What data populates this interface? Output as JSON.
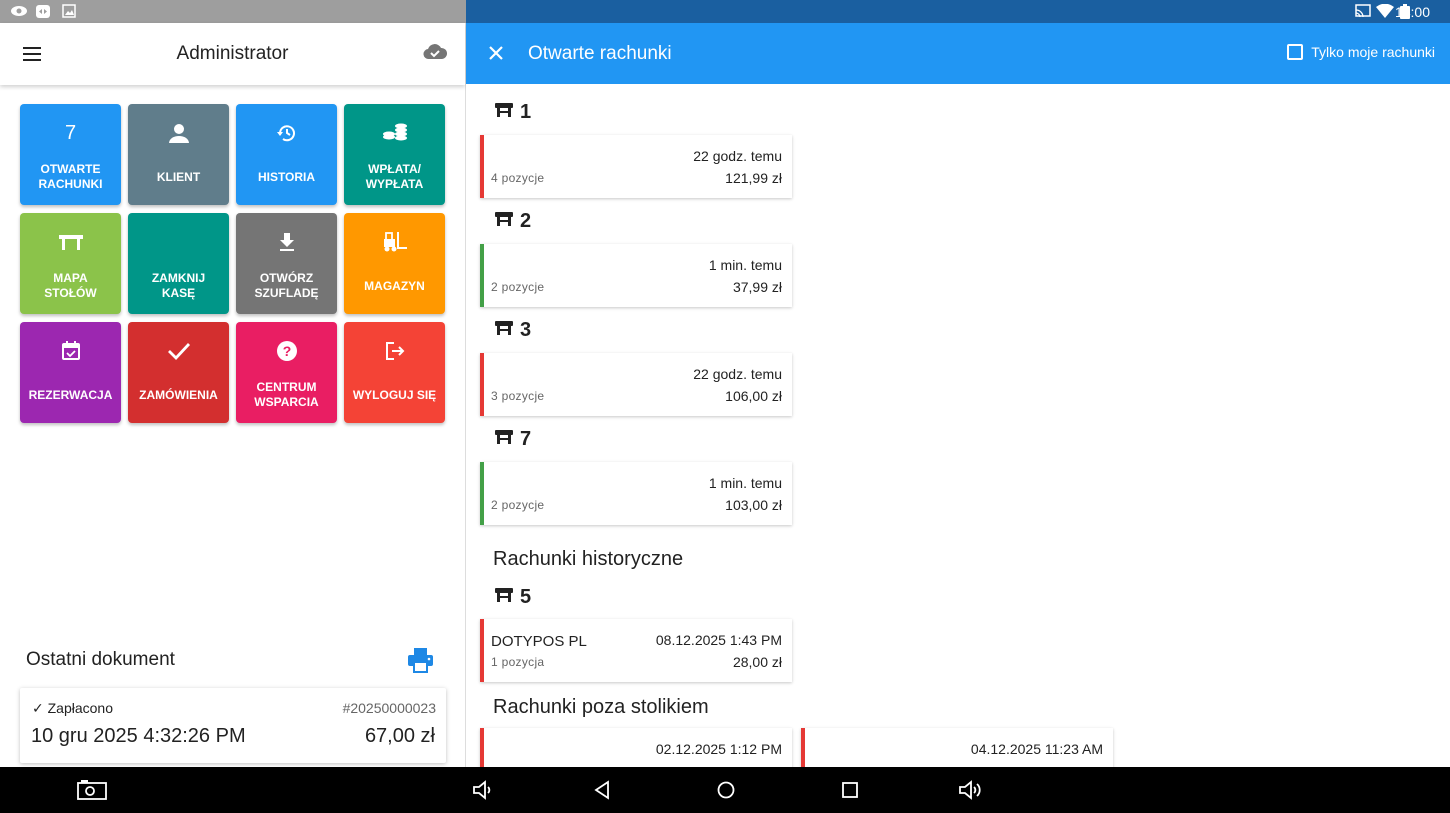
{
  "status": {
    "time": "14:00"
  },
  "left": {
    "title": "Administrator",
    "tiles": [
      {
        "label": "OTWARTE\nRACHUNKI",
        "icon_text": "7",
        "icon": "count-7",
        "color": "#2196f3"
      },
      {
        "label": "KLIENT",
        "icon": "person-icon",
        "color": "#607d8b"
      },
      {
        "label": "HISTORIA",
        "icon": "history-icon",
        "color": "#2196f3"
      },
      {
        "label": "WPŁATA/\nWYPŁATA",
        "icon": "coins-icon",
        "color": "#009688"
      },
      {
        "label": "MAPA\nSTOŁÓW",
        "icon": "table-icon",
        "color": "#8bc34a"
      },
      {
        "label": "ZAMKNIJ\nKASĘ",
        "icon": "none",
        "color": "#009688"
      },
      {
        "label": "OTWÓRZ\nSZUFLADĘ",
        "icon": "download-icon",
        "color": "#757575"
      },
      {
        "label": "MAGAZYN",
        "icon": "forklift-icon",
        "color": "#ff9800"
      },
      {
        "label": "REZERWACJA",
        "icon": "calendar-icon",
        "color": "#9c27b0"
      },
      {
        "label": "ZAMÓWIENIA",
        "icon": "check-icon",
        "color": "#d32f2f"
      },
      {
        "label": "CENTRUM\nWSPARCIA",
        "icon": "help-icon",
        "color": "#e91e63"
      },
      {
        "label": "WYLOGUJ SIĘ",
        "icon": "logout-icon",
        "color": "#f44336"
      }
    ],
    "last_doc": {
      "title": "Ostatni dokument",
      "status": "✓ Zapłacono",
      "number": "#20250000023",
      "date": "10 gru 2025 4:32:26 PM",
      "amount": "67,00 zł"
    }
  },
  "right": {
    "title": "Otwarte rachunki",
    "only_mine_label": "Tylko moje rachunki",
    "open_bills": [
      {
        "table": "1",
        "time": "22 godz. temu",
        "items": "4 pozycje",
        "amount": "121,99 zł",
        "stripe": "#e53935"
      },
      {
        "table": "2",
        "time": "1 min. temu",
        "items": "2 pozycje",
        "amount": "37,99 zł",
        "stripe": "#43a047"
      },
      {
        "table": "3",
        "time": "22 godz. temu",
        "items": "3 pozycje",
        "amount": "106,00 zł",
        "stripe": "#e53935"
      },
      {
        "table": "7",
        "time": "1 min. temu",
        "items": "2 pozycje",
        "amount": "103,00 zł",
        "stripe": "#43a047"
      }
    ],
    "history_heading": "Rachunki historyczne",
    "history_bills": [
      {
        "table": "5",
        "name": "DOTYPOS  PL",
        "time": "08.12.2025 1:43 PM",
        "items": "1 pozycja",
        "amount": "28,00 zł",
        "stripe": "#e53935"
      }
    ],
    "off_table_heading": "Rachunki poza stolikiem",
    "off_table_bills": [
      {
        "time": "02.12.2025 1:12 PM",
        "stripe": "#e53935"
      },
      {
        "time": "04.12.2025 11:23 AM",
        "stripe": "#e53935"
      }
    ]
  }
}
